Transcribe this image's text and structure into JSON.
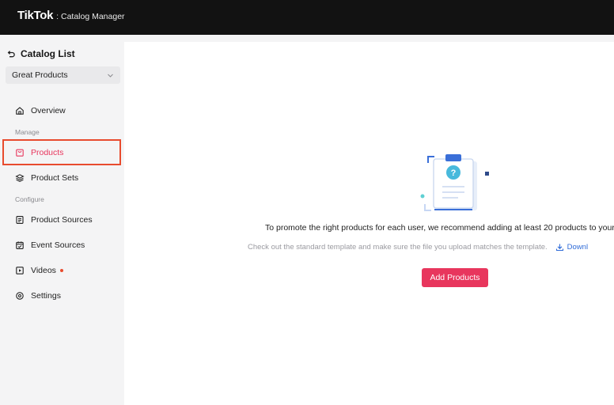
{
  "header": {
    "brand": "TikTok",
    "brand_suffix": ": Catalog Manager"
  },
  "sidebar": {
    "back_label": "Catalog List",
    "catalog_select": "Great Products",
    "items": {
      "overview": "Overview",
      "manage_section": "Manage",
      "products": "Products",
      "product_sets": "Product Sets",
      "configure_section": "Configure",
      "product_sources": "Product Sources",
      "event_sources": "Event Sources",
      "videos": "Videos",
      "settings": "Settings"
    }
  },
  "main": {
    "empty_title": "To promote the right products for each user, we recommend adding at least 20 products to your",
    "empty_subtitle": "Check out the standard template and make sure the file you upload matches the template.",
    "download_link": "Downl",
    "add_button": "Add Products"
  },
  "colors": {
    "accent": "#e8365d",
    "annotation": "#e84b2e",
    "link": "#2f6bd8",
    "topbar": "#121212"
  }
}
